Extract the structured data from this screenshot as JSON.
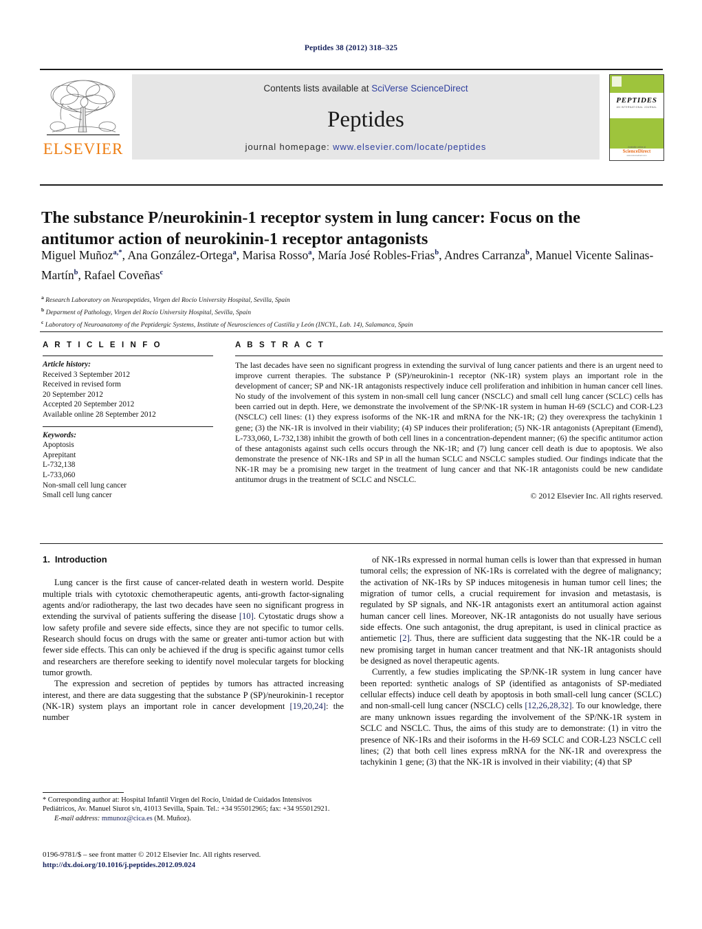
{
  "running_head": "Peptides 38 (2012) 318–325",
  "masthead": {
    "contents_prefix": "Contents lists available at ",
    "contents_link": "SciVerse ScienceDirect",
    "journal_name": "Peptides",
    "homepage_prefix": "journal homepage: ",
    "homepage_link": "www.elsevier.com/locate/peptides",
    "publisher_name": "ELSEVIER",
    "cover": {
      "title": "PEPTIDES",
      "subtitle": "AN INTERNATIONAL JOURNAL",
      "sd_small": "Available online at",
      "sd_brand": "ScienceDirect",
      "sd_url": "www.sciencedirect.com"
    }
  },
  "article": {
    "title": "The substance P/neurokinin-1 receptor system in lung cancer: Focus on the antitumor action of neurokinin-1 receptor antagonists",
    "authors": [
      {
        "name": "Miguel Muñoz",
        "marks": "a,*"
      },
      {
        "name": "Ana González-Ortega",
        "marks": "a"
      },
      {
        "name": "Marisa Rosso",
        "marks": "a"
      },
      {
        "name": "María José Robles-Frias",
        "marks": "b"
      },
      {
        "name": "Andres Carranza",
        "marks": "b"
      },
      {
        "name": "Manuel Vicente Salinas-Martín",
        "marks": "b"
      },
      {
        "name": "Rafael Coveñas",
        "marks": "c"
      }
    ],
    "affiliations": [
      {
        "label": "a",
        "text": "Research Laboratory on Neuropeptides, Virgen del Rocío University Hospital, Sevilla, Spain"
      },
      {
        "label": "b",
        "text": "Deparment of Pathology, Virgen del Rocío University Hospital, Sevilla, Spain"
      },
      {
        "label": "c",
        "text": "Laboratory of Neuroanatomy of the Peptidergic Systems, Institute of Neurosciences of Castilla y León (INCYL, Lab. 14), Salamanca, Spain"
      }
    ]
  },
  "article_info": {
    "heading": "A R T I C L E   I N F O",
    "history_label": "Article history:",
    "history": [
      "Received 3 September 2012",
      "Received in revised form",
      "20 September 2012",
      "Accepted 20 September 2012",
      "Available online 28 September 2012"
    ],
    "keywords_label": "Keywords:",
    "keywords": [
      "Apoptosis",
      "Aprepitant",
      "L-732,138",
      "L-733,060",
      "Non-small cell lung cancer",
      "Small cell lung cancer"
    ]
  },
  "abstract": {
    "heading": "A B S T R A C T",
    "text": "The last decades have seen no significant progress in extending the survival of lung cancer patients and there is an urgent need to improve current therapies. The substance P (SP)/neurokinin-1 receptor (NK-1R) system plays an important role in the development of cancer; SP and NK-1R antagonists respectively induce cell proliferation and inhibition in human cancer cell lines. No study of the involvement of this system in non-small cell lung cancer (NSCLC) and small cell lung cancer (SCLC) cells has been carried out in depth. Here, we demonstrate the involvement of the SP/NK-1R system in human H-69 (SCLC) and COR-L23 (NSCLC) cell lines: (1) they express isoforms of the NK-1R and mRNA for the NK-1R; (2) they overexpress the tachykinin 1 gene; (3) the NK-1R is involved in their viability; (4) SP induces their proliferation; (5) NK-1R antagonists (Aprepitant (Emend), L-733,060, L-732,138) inhibit the growth of both cell lines in a concentration-dependent manner; (6) the specific antitumor action of these antagonists against such cells occurs through the NK-1R; and (7) lung cancer cell death is due to apoptosis. We also demonstrate the presence of NK-1Rs and SP in all the human SCLC and NSCLC samples studied. Our findings indicate that the NK-1R may be a promising new target in the treatment of lung cancer and that NK-1R antagonists could be new candidate antitumor drugs in the treatment of SCLC and NSCLC.",
    "copyright": "© 2012 Elsevier Inc. All rights reserved."
  },
  "body": {
    "section_number": "1.",
    "section_title": "Introduction",
    "left_paragraphs": [
      "Lung cancer is the first cause of cancer-related death in western world. Despite multiple trials with cytotoxic chemotherapeutic agents, anti-growth factor-signaling agents and/or radiotherapy, the last two decades have seen no significant progress in extending the survival of patients suffering the disease [10]. Cytostatic drugs show a low safety profile and severe side effects, since they are not specific to tumor cells. Research should focus on drugs with the same or greater anti-tumor action but with fewer side effects. This can only be achieved if the drug is specific against tumor cells and researchers are therefore seeking to identify novel molecular targets for blocking tumor growth.",
      "The expression and secretion of peptides by tumors has attracted increasing interest, and there are data suggesting that the substance P (SP)/neurokinin-1 receptor (NK-1R) system plays an important role in cancer development [19,20,24]: the number"
    ],
    "right_paragraphs": [
      "of NK-1Rs expressed in normal human cells is lower than that expressed in human tumoral cells; the expression of NK-1Rs is correlated with the degree of malignancy; the activation of NK-1Rs by SP induces mitogenesis in human tumor cell lines; the migration of tumor cells, a crucial requirement for invasion and metastasis, is regulated by SP signals, and NK-1R antagonists exert an antitumoral action against human cancer cell lines. Moreover, NK-1R antagonists do not usually have serious side effects. One such antagonist, the drug aprepitant, is used in clinical practice as antiemetic [2]. Thus, there are sufficient data suggesting that the NK-1R could be a new promising target in human cancer treatment and that NK-1R antagonists should be designed as novel therapeutic agents.",
      "Currently, a few studies implicating the SP/NK-1R system in lung cancer have been reported: synthetic analogs of SP (identified as antagonists of SP-mediated cellular effects) induce cell death by apoptosis in both small-cell lung cancer (SCLC) and non-small-cell lung cancer (NSCLC) cells [12,26,28,32]. To our knowledge, there are many unknown issues regarding the involvement of the SP/NK-1R system in SCLC and NSCLC. Thus, the aims of this study are to demonstrate: (1) in vitro the presence of NK-1Rs and their isoforms in the H-69 SCLC and COR-L23 NSCLC cell lines; (2) that both cell lines express mRNA for the NK-1R and overexpress the tachykinin 1 gene; (3) that the NK-1R is involved in their viability; (4) that SP"
    ]
  },
  "footnotes": {
    "corresponding": "* Corresponding author at: Hospital Infantil Virgen del Rocío, Unidad de Cuidados Intensivos Pediátricos, Av. Manuel Siurot s/n, 41013 Sevilla, Spain. Tel.: +34 955012965; fax: +34 955012921.",
    "email_label": "E-mail address:",
    "email": "mmunoz@cica.es",
    "email_owner": "(M. Muñoz).",
    "issn_line": "0196-9781/$ – see front matter © 2012 Elsevier Inc. All rights reserved.",
    "doi": "http://dx.doi.org/10.1016/j.peptides.2012.09.024"
  },
  "colors": {
    "link_blue": "#2e3e9e",
    "ref_blue": "#16215b",
    "elsevier_orange": "#ee7d11",
    "cover_green": "#9ec43c",
    "mast_gray": "#e6e6e6"
  }
}
